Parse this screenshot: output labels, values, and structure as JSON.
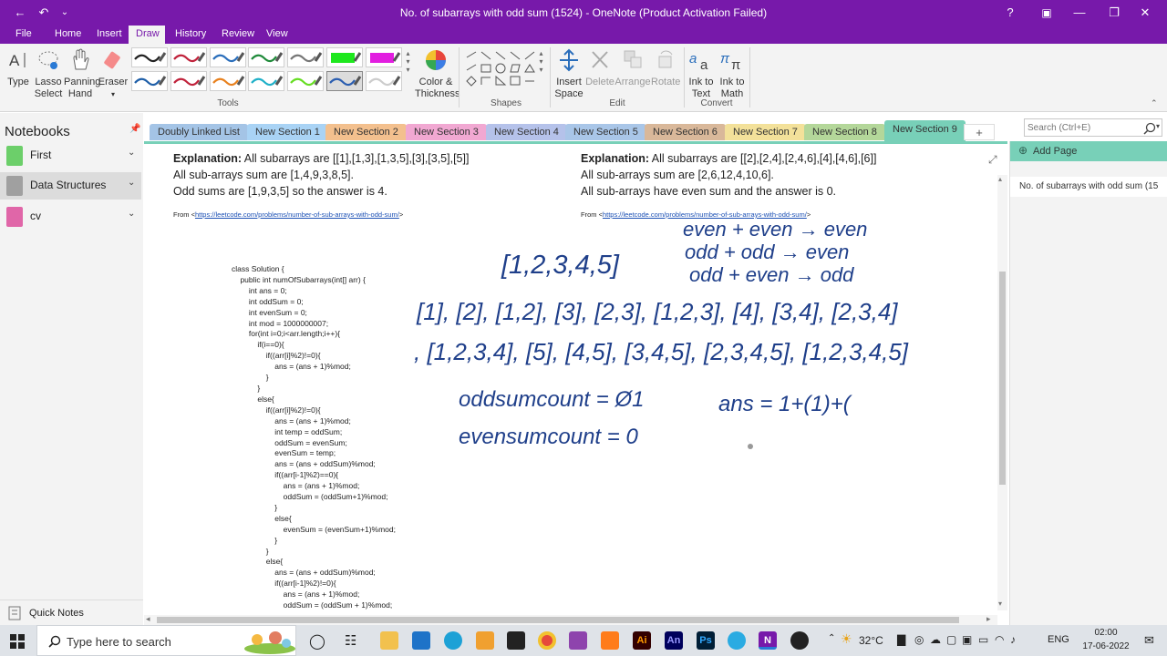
{
  "window": {
    "title": "No. of subarrays with odd sum (1524) - OneNote (Product Activation Failed)",
    "help": "?",
    "minimize": "—",
    "maximize": "❐",
    "close": "✕"
  },
  "ribbon_tabs": [
    "File",
    "Home",
    "Insert",
    "Draw",
    "History",
    "Review",
    "View"
  ],
  "ribbon": {
    "type": "Type",
    "lasso_select": "Lasso Select",
    "panning_hand": "Panning Hand",
    "eraser": "Eraser",
    "color_thickness": "Color & Thickness",
    "insert_space": "Insert Space",
    "delete": "Delete",
    "arrange": "Arrange",
    "rotate": "Rotate",
    "ink_to_text": "Ink to Text",
    "ink_to_math": "Ink to Math",
    "groups": {
      "tools": "Tools",
      "shapes": "Shapes",
      "edit": "Edit",
      "convert": "Convert"
    },
    "pen_colors": [
      "#222222",
      "#c0223b",
      "#2a6ebb",
      "#1f8a3a",
      "#777777",
      "#1ee81e",
      "#e21ee0",
      "#1f5fa8",
      "#c0223b",
      "#e8811e",
      "#1fb0c8",
      "#66dd22",
      "#2a5db0",
      "#cccccc",
      "#55dd22"
    ]
  },
  "notebooks": {
    "header": "Notebooks",
    "items": [
      {
        "label": "First",
        "color": "#6ccf6a"
      },
      {
        "label": "Data Structures",
        "color": "#a0a0a0"
      },
      {
        "label": "cv",
        "color": "#e066a8"
      }
    ],
    "quick_notes": "Quick Notes"
  },
  "sections": [
    {
      "label": "Doubly Linked List",
      "color": "#a4c4e6"
    },
    {
      "label": "New Section 1",
      "color": "#a9d3f5"
    },
    {
      "label": "New Section 2",
      "color": "#f3c08e"
    },
    {
      "label": "New Section 3",
      "color": "#f1a8d2"
    },
    {
      "label": "New Section 4",
      "color": "#b5c2ea"
    },
    {
      "label": "New Section 5",
      "color": "#a9c6e8"
    },
    {
      "label": "New Section 6",
      "color": "#d9b89a"
    },
    {
      "label": "New Section 7",
      "color": "#f3e19a"
    },
    {
      "label": "New Section 8",
      "color": "#b4d79a"
    },
    {
      "label": "New Section 9",
      "color": "#78d0b8"
    }
  ],
  "add_section": "+",
  "search": {
    "placeholder": "Search (Ctrl+E)"
  },
  "pages": {
    "add_page": "Add Page",
    "items": [
      "No. of subarrays with odd sum (15"
    ]
  },
  "content": {
    "left": {
      "explanation_label": "Explanation:",
      "explanation": " All subarrays are [[1],[1,3],[1,3,5],[3],[3,5],[5]]",
      "line2": "All sub-arrays sum are [1,4,9,3,8,5].",
      "line3": "Odd sums are [1,9,3,5] so the answer is 4.",
      "from": "From <",
      "link": "https://leetcode.com/problems/number-of-sub-arrays-with-odd-sum/",
      "from_end": ">"
    },
    "right": {
      "explanation_label": "Explanation:",
      "explanation": " All subarrays are [[2],[2,4],[2,4,6],[4],[4,6],[6]]",
      "line2": "All sub-arrays sum are [2,6,12,4,10,6].",
      "line3": "All sub-arrays have even sum and the answer is 0.",
      "from": "From <",
      "link": "https://leetcode.com/problems/number-of-sub-arrays-with-odd-sum/",
      "from_end": ">"
    },
    "code": [
      "class Solution {",
      "    public int numOfSubarrays(int[] arr) {",
      "        int ans = 0;",
      "        int oddSum = 0;",
      "        int evenSum = 0;",
      "        int mod = 1000000007;",
      "        for(int i=0;i<arr.length;i++){",
      "            if(i==0){",
      "                if((arr[i]%2)!=0){",
      "                    ans = (ans + 1)%mod;",
      "                }",
      "            }",
      "            else{",
      "                if((arr[i]%2)!=0){",
      "                    ans = (ans + 1)%mod;",
      "                    int temp = oddSum;",
      "                    oddSum = evenSum;",
      "                    evenSum = temp;",
      "                    ans = (ans + oddSum)%mod;",
      "                    if((arr[i-1]%2)==0){",
      "                        ans = (ans + 1)%mod;",
      "                        oddSum = (oddSum+1)%mod;",
      "                    }",
      "                    else{",
      "                        evenSum = (evenSum+1)%mod;",
      "                    }",
      "                }",
      "                else{",
      "                    ans = (ans + oddSum)%mod;",
      "                    if((arr[i-1]%2)!=0){",
      "                        ans = (ans + 1)%mod;",
      "                        oddSum = (oddSum + 1)%mod;"
    ],
    "ink": {
      "array": "[1,2,3,4,5]",
      "rule1": "even + even → even",
      "rule2": "odd + odd → even",
      "rule3": "odd + even → odd",
      "subarrays1": "[1], [2], [1,2], [3], [2,3], [1,2,3], [4], [3,4], [2,3,4]",
      "subarrays2": ", [1,2,3,4], [5], [4,5], [3,4,5], [2,3,4,5], [1,2,3,4,5]",
      "oddsum": "oddsumcount = Ø1",
      "evensum": "evensumcount = 0",
      "ans": "ans = 1+(1)+("
    }
  },
  "taskbar": {
    "search_placeholder": "Type here to search",
    "weather": "32°C",
    "language": "ENG",
    "time": "02:00",
    "date": "17-06-2022"
  }
}
